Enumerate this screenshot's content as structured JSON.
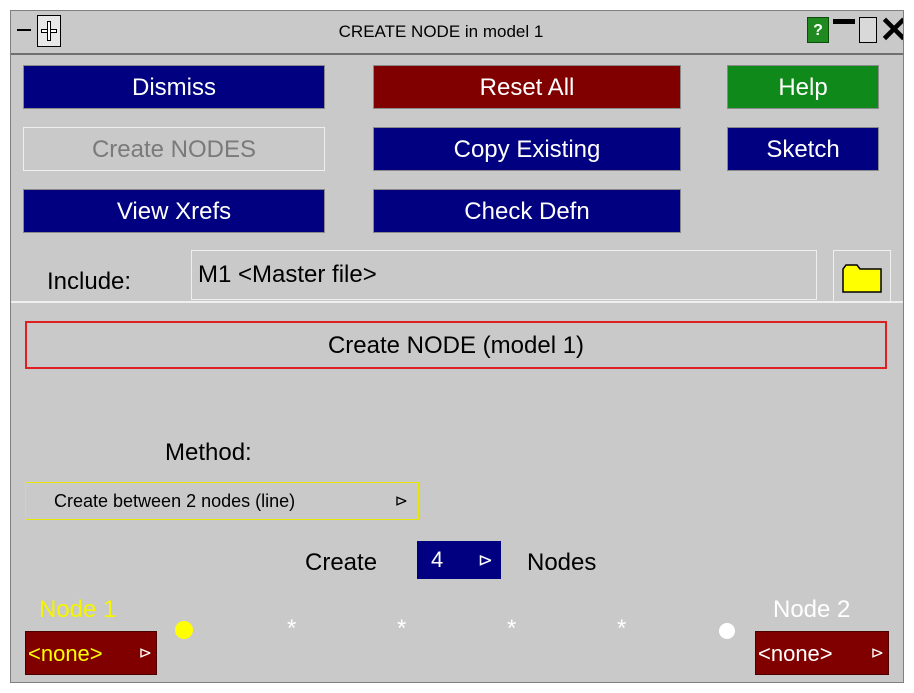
{
  "window": {
    "title": "CREATE NODE in model 1",
    "help_glyph": "?",
    "close_glyph": "✕"
  },
  "buttons": {
    "dismiss": "Dismiss",
    "reset_all": "Reset All",
    "help": "Help",
    "create_nodes": "Create NODES",
    "copy_existing": "Copy Existing",
    "sketch": "Sketch",
    "view_xrefs": "View Xrefs",
    "check_defn": "Check Defn"
  },
  "include": {
    "label": "Include:",
    "value": "M1  <Master file>"
  },
  "section": {
    "title": "Create NODE (model 1)"
  },
  "method": {
    "label": "Method:",
    "selected": "Create between 2 nodes (line)",
    "arrow": "⊳"
  },
  "count": {
    "create_label": "Create",
    "value": "4",
    "nodes_label": "Nodes",
    "arrow": "⊳"
  },
  "node1": {
    "label": "Node 1",
    "value": "<none>",
    "arrow": "⊳"
  },
  "node2": {
    "label": "Node 2",
    "value": "<none>",
    "arrow": "⊳"
  },
  "preview": {
    "star_glyph": "*"
  },
  "colors": {
    "panel_bg": "#c9c9c9",
    "navy": "#000080",
    "maroon": "#800000",
    "green": "#0f8a1a",
    "node1_yellow": "#ffff00",
    "section_border": "#e02020"
  }
}
